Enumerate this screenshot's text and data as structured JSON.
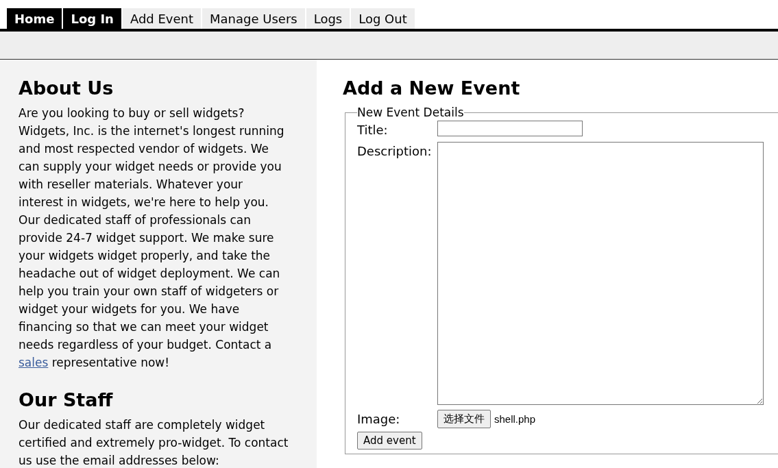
{
  "nav": {
    "tabs": [
      {
        "label": "Home",
        "active": true
      },
      {
        "label": "Log In",
        "active": true
      },
      {
        "label": "Add Event",
        "active": false
      },
      {
        "label": "Manage Users",
        "active": false
      },
      {
        "label": "Logs",
        "active": false
      },
      {
        "label": "Log Out",
        "active": false
      }
    ]
  },
  "sidebar": {
    "sections": [
      {
        "heading": "About Us",
        "paragraph": "Are you looking to buy or sell widgets? Widgets, Inc. is the internet's longest running and most respected vendor of widgets. We can supply your widget needs or provide you with reseller materials. Whatever your interest in widgets, we're here to help you. Our dedicated staff of professionals can provide 24-7 widget support. We make sure your widgets widget properly, and take the headache out of widget deployment. We can help you train your own staff of widgeters or widget your widgets for you. We have financing so that we can meet your widget needs regardless of your budget. Contact a",
        "link": "sales",
        "after": "representative now!"
      },
      {
        "heading": "Our Staff",
        "paragraph": "Our dedicated staff are completely widget certified and extremely pro-widget. To contact us use the email addresses below:"
      }
    ]
  },
  "form": {
    "heading": "Add a New Event",
    "legend": "New Event Details",
    "title_label": "Title:",
    "description_label": "Description:",
    "image_label": "Image:",
    "file_button": "选择文件",
    "file_name": "shell.php",
    "submit": "Add event"
  }
}
